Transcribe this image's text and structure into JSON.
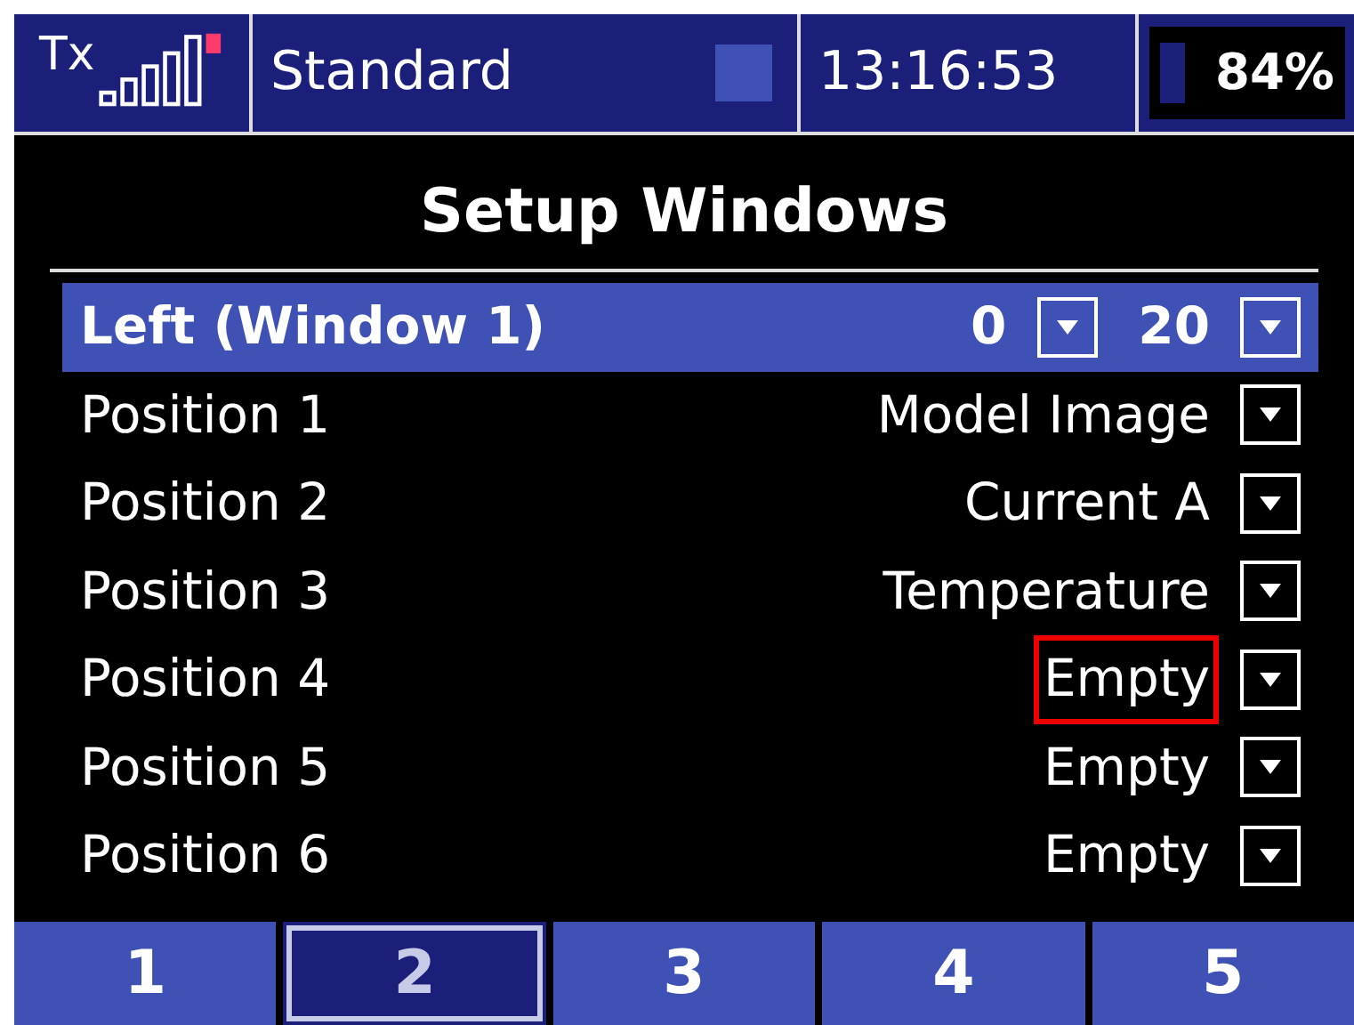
{
  "status_bar": {
    "tx_label": "Tx",
    "model": "Standard",
    "time": "13:16:53",
    "battery": "84%"
  },
  "title": "Setup Windows",
  "rows": [
    {
      "label": "Left (Window 1)",
      "selected": true,
      "values": [
        "0",
        "20"
      ],
      "highlighted": false
    },
    {
      "label": "Position 1",
      "selected": false,
      "values": [
        "Model Image"
      ],
      "highlighted": false
    },
    {
      "label": "Position 2",
      "selected": false,
      "values": [
        "Current A"
      ],
      "highlighted": false
    },
    {
      "label": "Position 3",
      "selected": false,
      "values": [
        "Temperature"
      ],
      "highlighted": false
    },
    {
      "label": "Position 4",
      "selected": false,
      "values": [
        "Empty"
      ],
      "highlighted": true
    },
    {
      "label": "Position 5",
      "selected": false,
      "values": [
        "Empty"
      ],
      "highlighted": false
    },
    {
      "label": "Position 6",
      "selected": false,
      "values": [
        "Empty"
      ],
      "highlighted": false
    }
  ],
  "pages": [
    {
      "label": "1",
      "selected": false
    },
    {
      "label": "2",
      "selected": true
    },
    {
      "label": "3",
      "selected": false
    },
    {
      "label": "4",
      "selected": false
    },
    {
      "label": "5",
      "selected": false
    }
  ]
}
